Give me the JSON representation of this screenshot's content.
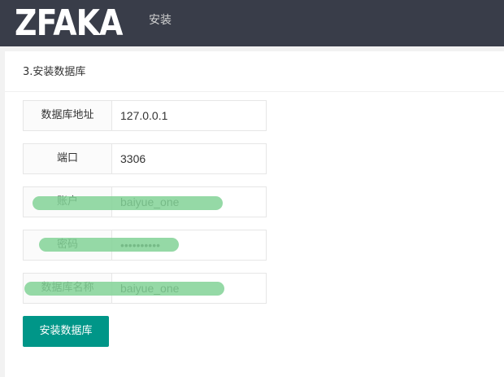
{
  "header": {
    "logo": "ZFAKA",
    "nav": [
      {
        "label": "安装"
      }
    ]
  },
  "card": {
    "title": "3.安装数据库"
  },
  "form": {
    "fields": [
      {
        "label": "数据库地址",
        "value": "127.0.0.1"
      },
      {
        "label": "端口",
        "value": "3306"
      },
      {
        "label": "账户",
        "value": "baiyue_one"
      },
      {
        "label": "密码",
        "value": "••••••••••"
      },
      {
        "label": "数据库名称",
        "value": "baiyue_one"
      }
    ],
    "submit_label": "安装数据库"
  },
  "colors": {
    "header_bg": "#393d49",
    "button_bg": "#009688",
    "highlight": "#82d296"
  }
}
